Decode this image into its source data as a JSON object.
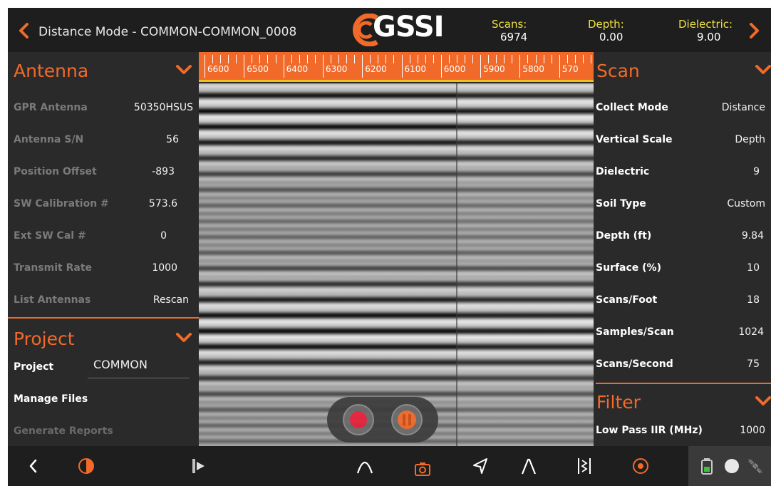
{
  "header": {
    "title": "Distance Mode - COMMON-COMMON_0008",
    "logo_text": "GSSI",
    "stats": [
      {
        "label": "Scans:",
        "value": "6974"
      },
      {
        "label": "Depth:",
        "value": "0.00"
      },
      {
        "label": "Dielectric:",
        "value": "9.00"
      }
    ]
  },
  "colors": {
    "accent": "#f26a2a",
    "stat_label": "#f0e040",
    "record": "#e8203a"
  },
  "antenna": {
    "title": "Antenna",
    "rows": [
      {
        "key": "GPR Antenna",
        "value": "50350HSUS"
      },
      {
        "key": "Antenna S/N",
        "value": "56"
      },
      {
        "key": "Position Offset",
        "value": "-893"
      },
      {
        "key": "SW Calibration #",
        "value": "573.6"
      },
      {
        "key": "Ext SW Cal #",
        "value": "0"
      },
      {
        "key": "Transmit Rate",
        "value": "1000"
      },
      {
        "key": "List Antennas",
        "value": "Rescan"
      }
    ]
  },
  "project": {
    "title": "Project",
    "project_label": "Project",
    "project_value": "COMMON",
    "manage_files": "Manage Files",
    "generate_reports": "Generate Reports"
  },
  "scan": {
    "title": "Scan",
    "rows": [
      {
        "key": "Collect Mode",
        "value": "Distance"
      },
      {
        "key": "Vertical Scale",
        "value": "Depth"
      },
      {
        "key": "Dielectric",
        "value": "9"
      },
      {
        "key": "Soil Type",
        "value": "Custom"
      },
      {
        "key": "Depth (ft)",
        "value": "9.84"
      },
      {
        "key": "Surface (%)",
        "value": "10"
      },
      {
        "key": "Scans/Foot",
        "value": "18"
      },
      {
        "key": "Samples/Scan",
        "value": "1024"
      },
      {
        "key": "Scans/Second",
        "value": "75"
      }
    ]
  },
  "filter": {
    "title": "Filter",
    "rows": [
      {
        "key": "Low Pass IIR (MHz)",
        "value": "1000"
      }
    ]
  },
  "ruler": {
    "labels": [
      "6600",
      "6500",
      "6400",
      "6300",
      "6200",
      "6100",
      "6000",
      "5900",
      "5800",
      "570"
    ]
  },
  "toolbar_icons": [
    "back-icon",
    "contrast-icon",
    "mark-start-icon",
    "hyperbola-icon",
    "camera-icon",
    "navigate-icon",
    "peak-icon",
    "split-icon",
    "target-icon"
  ],
  "status_icons": [
    "battery-icon",
    "gps-dot-icon",
    "satellite-icon"
  ]
}
